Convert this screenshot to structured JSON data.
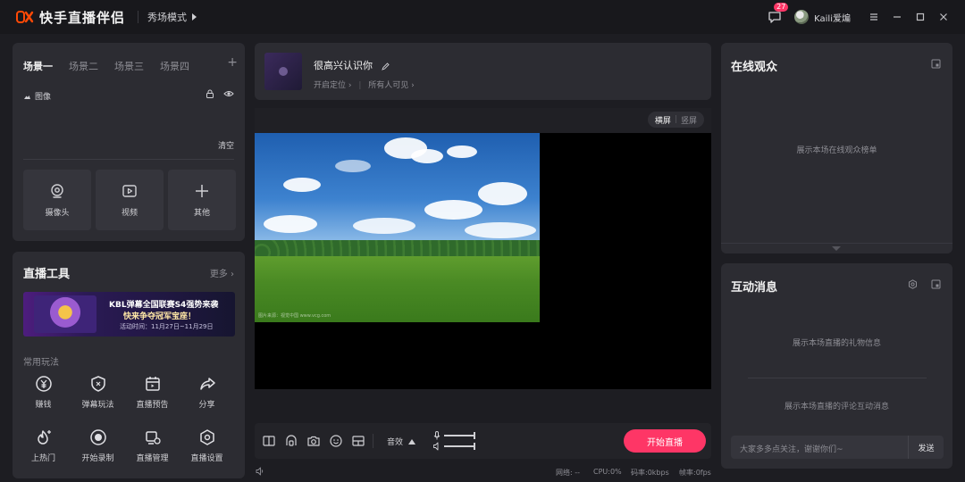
{
  "app": {
    "name": "快手直播伴侣",
    "mode": "秀场模式"
  },
  "titlebar": {
    "notification_count": "27",
    "username": "Kaili爱煸"
  },
  "scenes": {
    "tabs": [
      "场景一",
      "场景二",
      "场景三",
      "场景四"
    ],
    "add": "+",
    "source_name": "图像",
    "clear_label": "清空",
    "buttons": [
      "摄像头",
      "视频",
      "其他"
    ]
  },
  "tools": {
    "title": "直播工具",
    "more": "更多 ›",
    "banner": {
      "line1": "KBL弹幕全国联赛S4强势来袭",
      "line2": "快来争夺冠军宝座！",
      "line3": "活动时间：11月27日~11月29日"
    },
    "common_label": "常用玩法",
    "items": [
      "赚钱",
      "弹幕玩法",
      "直播预告",
      "分享",
      "上热门",
      "开始录制",
      "直播管理",
      "直播设置"
    ]
  },
  "room": {
    "title": "很高兴认识你",
    "location": "开启定位 ›",
    "visibility": "所有人可见 ›"
  },
  "preview": {
    "landscape": "横屏",
    "portrait": "竖屏",
    "watermark": "图片来源：视觉中国 www.vcg.com"
  },
  "controls": {
    "effect_label": "音效",
    "start_label": "开始直播"
  },
  "status": {
    "network": "网络: --",
    "cpu": "CPU:0%",
    "bitrate": "码率:0kbps",
    "fps": "帧率:0fps"
  },
  "audience": {
    "title": "在线观众",
    "empty": "展示本场在线观众榜单"
  },
  "interaction": {
    "title": "互动消息",
    "gift_empty": "展示本场直播的礼物信息",
    "comment_empty": "展示本场直播的评论互动消息",
    "input_placeholder": "大家多多点关注，谢谢你们~",
    "send_label": "发送"
  },
  "colors": {
    "accent": "#fe3666",
    "panel": "#2c2c32",
    "background": "#1d1d22"
  }
}
